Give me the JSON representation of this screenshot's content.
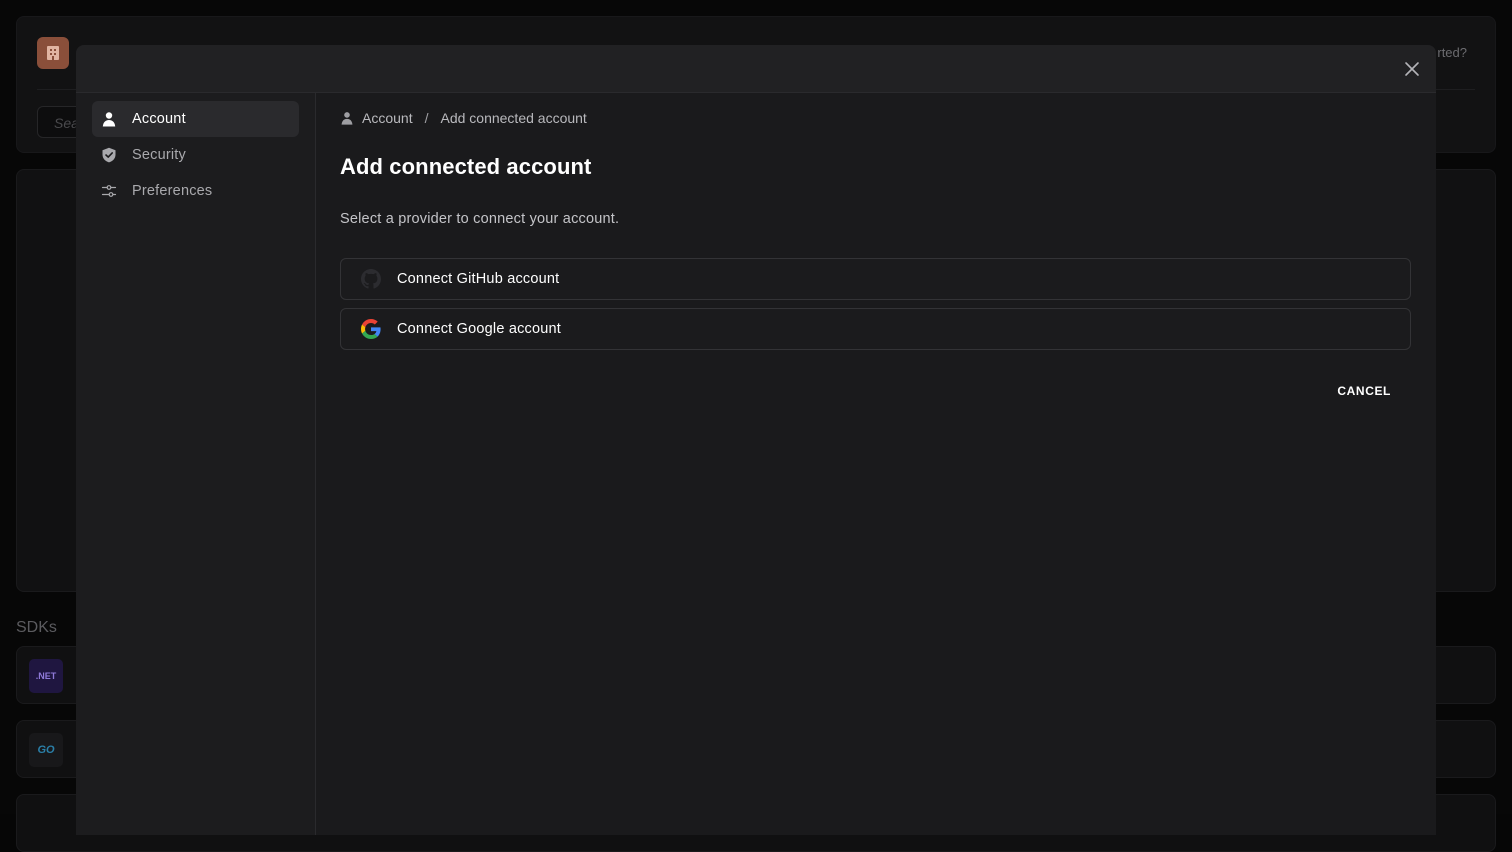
{
  "background": {
    "search_placeholder": "Sea",
    "help_text": "rted?",
    "sdks_title": "SDKs",
    "sdk_cards": [
      {
        "icon_label": ".NET",
        "icon": "dotnet-icon"
      },
      {
        "icon_label": "GO",
        "icon": "go-icon"
      }
    ]
  },
  "sidebar": {
    "items": [
      {
        "label": "Account",
        "icon": "user-icon",
        "active": true
      },
      {
        "label": "Security",
        "icon": "shield-icon",
        "active": false
      },
      {
        "label": "Preferences",
        "icon": "sliders-icon",
        "active": false
      }
    ]
  },
  "breadcrumb": {
    "items": [
      "Account",
      "Add connected account"
    ],
    "separator": "/"
  },
  "main": {
    "title": "Add connected account",
    "subtitle": "Select a provider to connect your account.",
    "providers": [
      {
        "label": "Connect GitHub account",
        "icon": "github-icon"
      },
      {
        "label": "Connect Google account",
        "icon": "google-icon"
      }
    ],
    "cancel_label": "CANCEL"
  },
  "colors": {
    "modal_bg": "#1a1a1c",
    "active_item_bg": "#2a2a2d",
    "logo_bg": "#8a4f3a"
  }
}
